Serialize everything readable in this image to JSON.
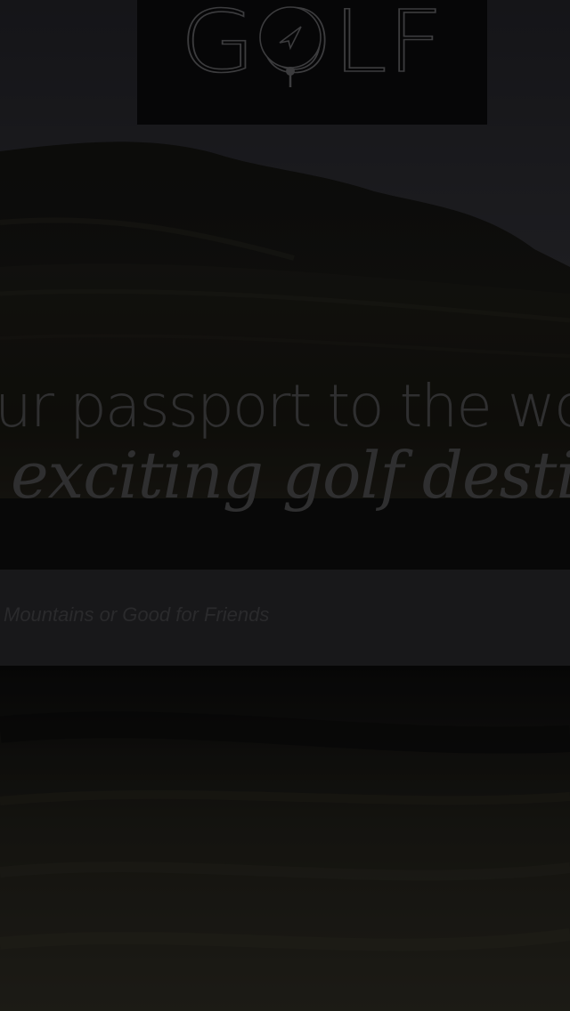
{
  "logo": {
    "text": "GOLF",
    "icon": "compass-pin-icon"
  },
  "hero": {
    "line1": "ur passport to the wo",
    "line2": "exciting golf destin"
  },
  "search": {
    "placeholder": "Mountains or Good for Friends"
  },
  "colors": {
    "background": "#0b0b0c",
    "search_bar": "#18181a",
    "text_dim": "#2f2f30"
  }
}
